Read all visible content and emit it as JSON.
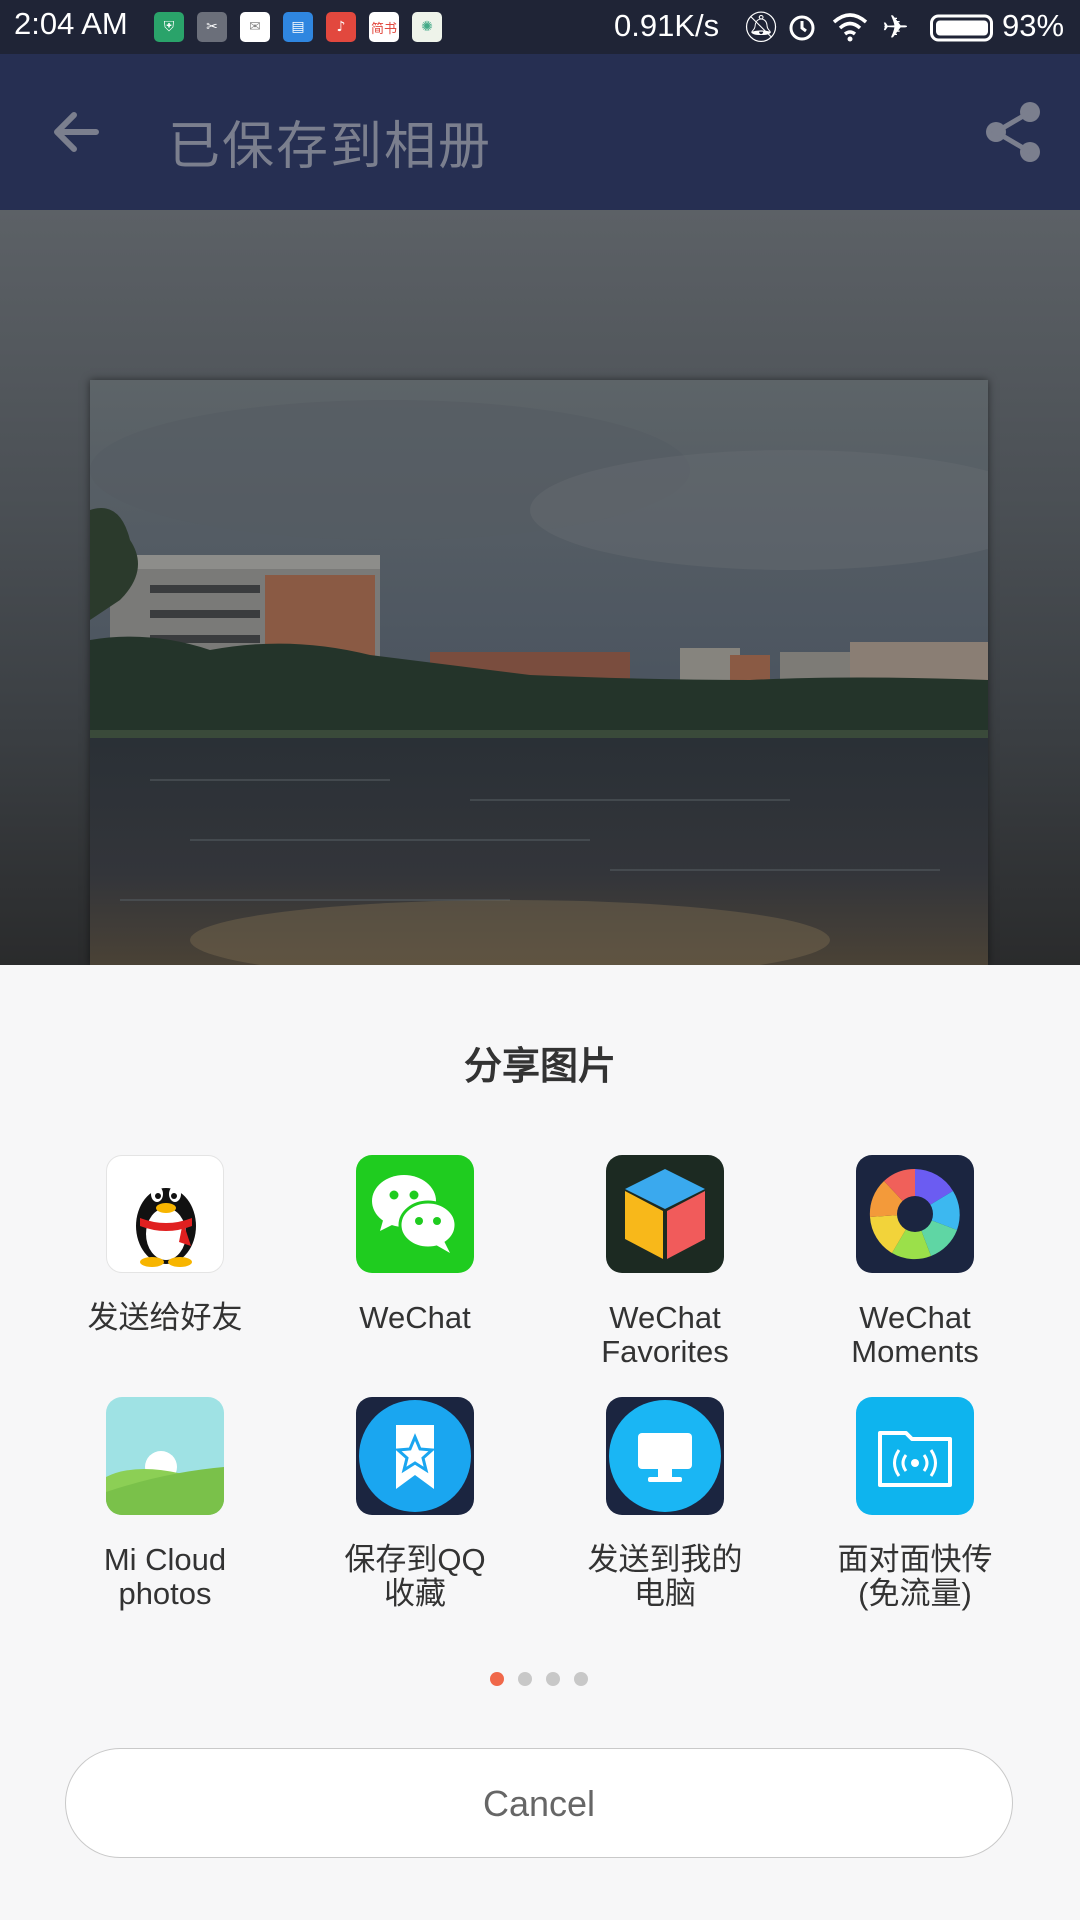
{
  "status_bar": {
    "time": "2:04 AM",
    "net_speed": "0.91K/s",
    "battery": "93%",
    "notification_icons": [
      "shield-icon",
      "scissors-icon",
      "mail-icon",
      "message-icon",
      "music-icon",
      "jianshu-icon",
      "logo-icon"
    ],
    "jianshu_text": "简书"
  },
  "app_bar": {
    "title": "已保存到相册",
    "back_icon": "arrow-left-icon",
    "share_icon": "share-icon"
  },
  "sheet": {
    "title": "分享图片",
    "targets": [
      {
        "label": "发送给好友",
        "icon": "qq-penguin-icon"
      },
      {
        "label": "WeChat",
        "icon": "wechat-icon"
      },
      {
        "label": "WeChat Favorites",
        "icon": "wechat-favorites-cube-icon"
      },
      {
        "label": "WeChat Moments",
        "icon": "wechat-moments-aperture-icon"
      },
      {
        "label": "Mi Cloud photos",
        "icon": "mi-cloud-photos-icon"
      },
      {
        "label": "保存到QQ收藏",
        "icon": "qq-favorites-star-icon"
      },
      {
        "label": "发送到我的电脑",
        "icon": "send-to-computer-icon"
      },
      {
        "label": "面对面快传(免流量)",
        "icon": "face-to-face-transfer-icon"
      }
    ],
    "page_indicator": {
      "count": 4,
      "active": 0,
      "active_color": "#f0684a"
    },
    "cancel_label": "Cancel"
  },
  "colors": {
    "status_bar": "#1f2436",
    "app_bar": "#262f52",
    "sheet_bg": "#f7f7f8"
  }
}
